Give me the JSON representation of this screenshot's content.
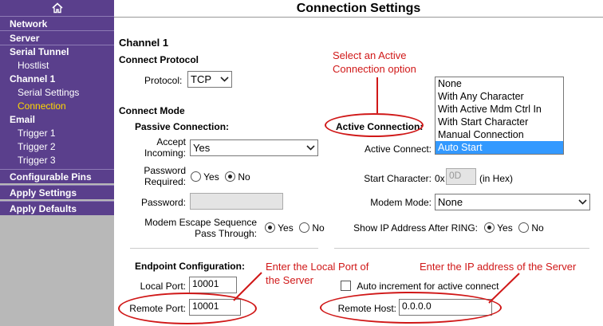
{
  "sidebar": {
    "home_icon": "home-icon",
    "network": "Network",
    "server": "Server",
    "serial_tunnel": "Serial Tunnel",
    "hostlist": "Hostlist",
    "channel1": "Channel 1",
    "serial_settings": "Serial Settings",
    "connection": "Connection",
    "email": "Email",
    "trigger1": "Trigger 1",
    "trigger2": "Trigger 2",
    "trigger3": "Trigger 3",
    "configurable_pins": "Configurable Pins",
    "apply_settings": "Apply Settings",
    "apply_defaults": "Apply Defaults"
  },
  "page_title": "Connection Settings",
  "channel_title": "Channel 1",
  "connect_protocol": {
    "heading": "Connect Protocol",
    "label": "Protocol:",
    "value": "TCP"
  },
  "connect_mode": {
    "heading": "Connect Mode",
    "passive_heading": "Passive Connection:",
    "accept_incoming_label_1": "Accept",
    "accept_incoming_label_2": "Incoming:",
    "accept_incoming_value": "Yes",
    "password_required_label_1": "Password",
    "password_required_label_2": "Required:",
    "yes": "Yes",
    "no": "No",
    "password_label": "Password:",
    "modem_escape_label_1": "Modem Escape Sequence",
    "modem_escape_label_2": "Pass Through:",
    "active_heading": "Active Connection:",
    "active_connect_label": "Active Connect:",
    "active_connect_options": [
      "None",
      "With Any Character",
      "With Active Mdm Ctrl In",
      "With Start Character",
      "Manual Connection",
      "Auto Start"
    ],
    "active_connect_selected": "Auto Start",
    "start_character_label": "Start Character:",
    "start_character_prefix": "0x",
    "start_character_value": "0D",
    "start_character_suffix": "(in Hex)",
    "modem_mode_label": "Modem Mode:",
    "modem_mode_value": "None",
    "show_ip_label": "Show IP Address After RING:"
  },
  "endpoint": {
    "heading": "Endpoint Configuration:",
    "local_port_label": "Local Port:",
    "local_port_value": "10001",
    "remote_port_label": "Remote Port:",
    "remote_port_value": "10001",
    "auto_increment_label": "Auto increment for active connect",
    "remote_host_label": "Remote Host:",
    "remote_host_value": "0.0.0.0"
  },
  "annotations": {
    "select_active_1": "Select an Active",
    "select_active_2": "Connection option",
    "local_port_1": "Enter the Local Port of",
    "local_port_2": "the Server",
    "ip_address": "Enter the IP address of the Server"
  },
  "colors": {
    "sidebar_purple": "#5a3f8c",
    "sidebar_gray": "#b8b8b8",
    "annotation_red": "#d01818",
    "highlight_yellow": "#ffd700",
    "list_selected": "#3399ff"
  }
}
